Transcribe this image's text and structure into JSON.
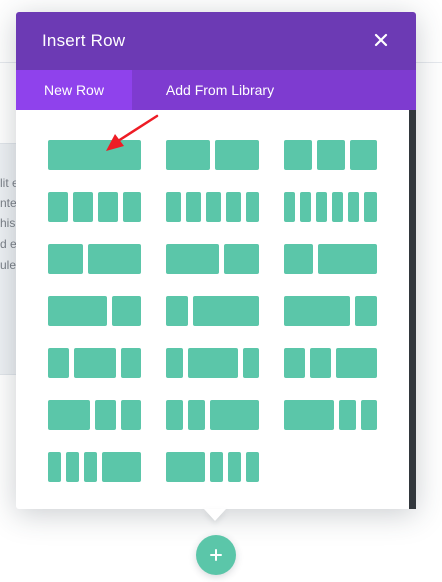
{
  "modal": {
    "title": "Insert Row",
    "close_icon": "close-icon",
    "tabs": [
      {
        "label": "New Row",
        "active": true
      },
      {
        "label": "Add From Library",
        "active": false
      }
    ]
  },
  "row_layouts": [
    {
      "id": "1",
      "columns": [
        "1"
      ]
    },
    {
      "id": "1-2_1-2",
      "columns": [
        "1/2",
        "1/2"
      ]
    },
    {
      "id": "1-3x3",
      "columns": [
        "1/3",
        "1/3",
        "1/3"
      ]
    },
    {
      "id": "1-4x4",
      "columns": [
        "1/4",
        "1/4",
        "1/4",
        "1/4"
      ]
    },
    {
      "id": "1-5x5",
      "columns": [
        "1/5",
        "1/5",
        "1/5",
        "1/5",
        "1/5"
      ]
    },
    {
      "id": "1-6x6",
      "columns": [
        "1/6",
        "1/6",
        "1/6",
        "1/6",
        "1/6",
        "1/6"
      ]
    },
    {
      "id": "2-5_3-5",
      "columns": [
        "2/5",
        "3/5"
      ]
    },
    {
      "id": "3-5_2-5",
      "columns": [
        "3/5",
        "2/5"
      ]
    },
    {
      "id": "1-3_2-3",
      "columns": [
        "1/3",
        "2/3"
      ]
    },
    {
      "id": "2-3_1-3",
      "columns": [
        "2/3",
        "1/3"
      ]
    },
    {
      "id": "1-4_3-4",
      "columns": [
        "1/4",
        "3/4"
      ]
    },
    {
      "id": "3-4_1-4",
      "columns": [
        "3/4",
        "1/4"
      ]
    },
    {
      "id": "1-4_1-2_1-4",
      "columns": [
        "1/4",
        "1/2",
        "1/4"
      ]
    },
    {
      "id": "1-5_3-5_1-5",
      "columns": [
        "1/5",
        "3/5",
        "1/5"
      ]
    },
    {
      "id": "1-4_1-4_1-2",
      "columns": [
        "1/4",
        "1/4",
        "1/2"
      ]
    },
    {
      "id": "1-2_1-4_1-4",
      "columns": [
        "1/2",
        "1/4",
        "1/4"
      ]
    },
    {
      "id": "1-5_1-5_3-5",
      "columns": [
        "1/5",
        "1/5",
        "3/5"
      ]
    },
    {
      "id": "3-5_1-5_1-5",
      "columns": [
        "3/5",
        "1/5",
        "1/5"
      ]
    },
    {
      "id": "1-6_1-6_1-6_1-2",
      "columns": [
        "1/6",
        "1/6",
        "1/6",
        "1/2"
      ]
    },
    {
      "id": "1-2_1-6_1-6_1-6",
      "columns": [
        "1/2",
        "1/6",
        "1/6",
        "1/6"
      ]
    }
  ],
  "annotation": {
    "icon": "red-arrow-icon",
    "color": "#ee1c25",
    "target": "row_layouts.0"
  },
  "add_button": {
    "icon": "plus-icon",
    "color": "#5bc6a9"
  },
  "background_text": [
    "lit e",
    "nte",
    "his",
    "d e",
    "ule"
  ],
  "colors": {
    "header": "#6c3ab4",
    "tab_bar": "#7e3bd0",
    "tab_active": "#8f42ec",
    "column": "#5bc6a9"
  }
}
